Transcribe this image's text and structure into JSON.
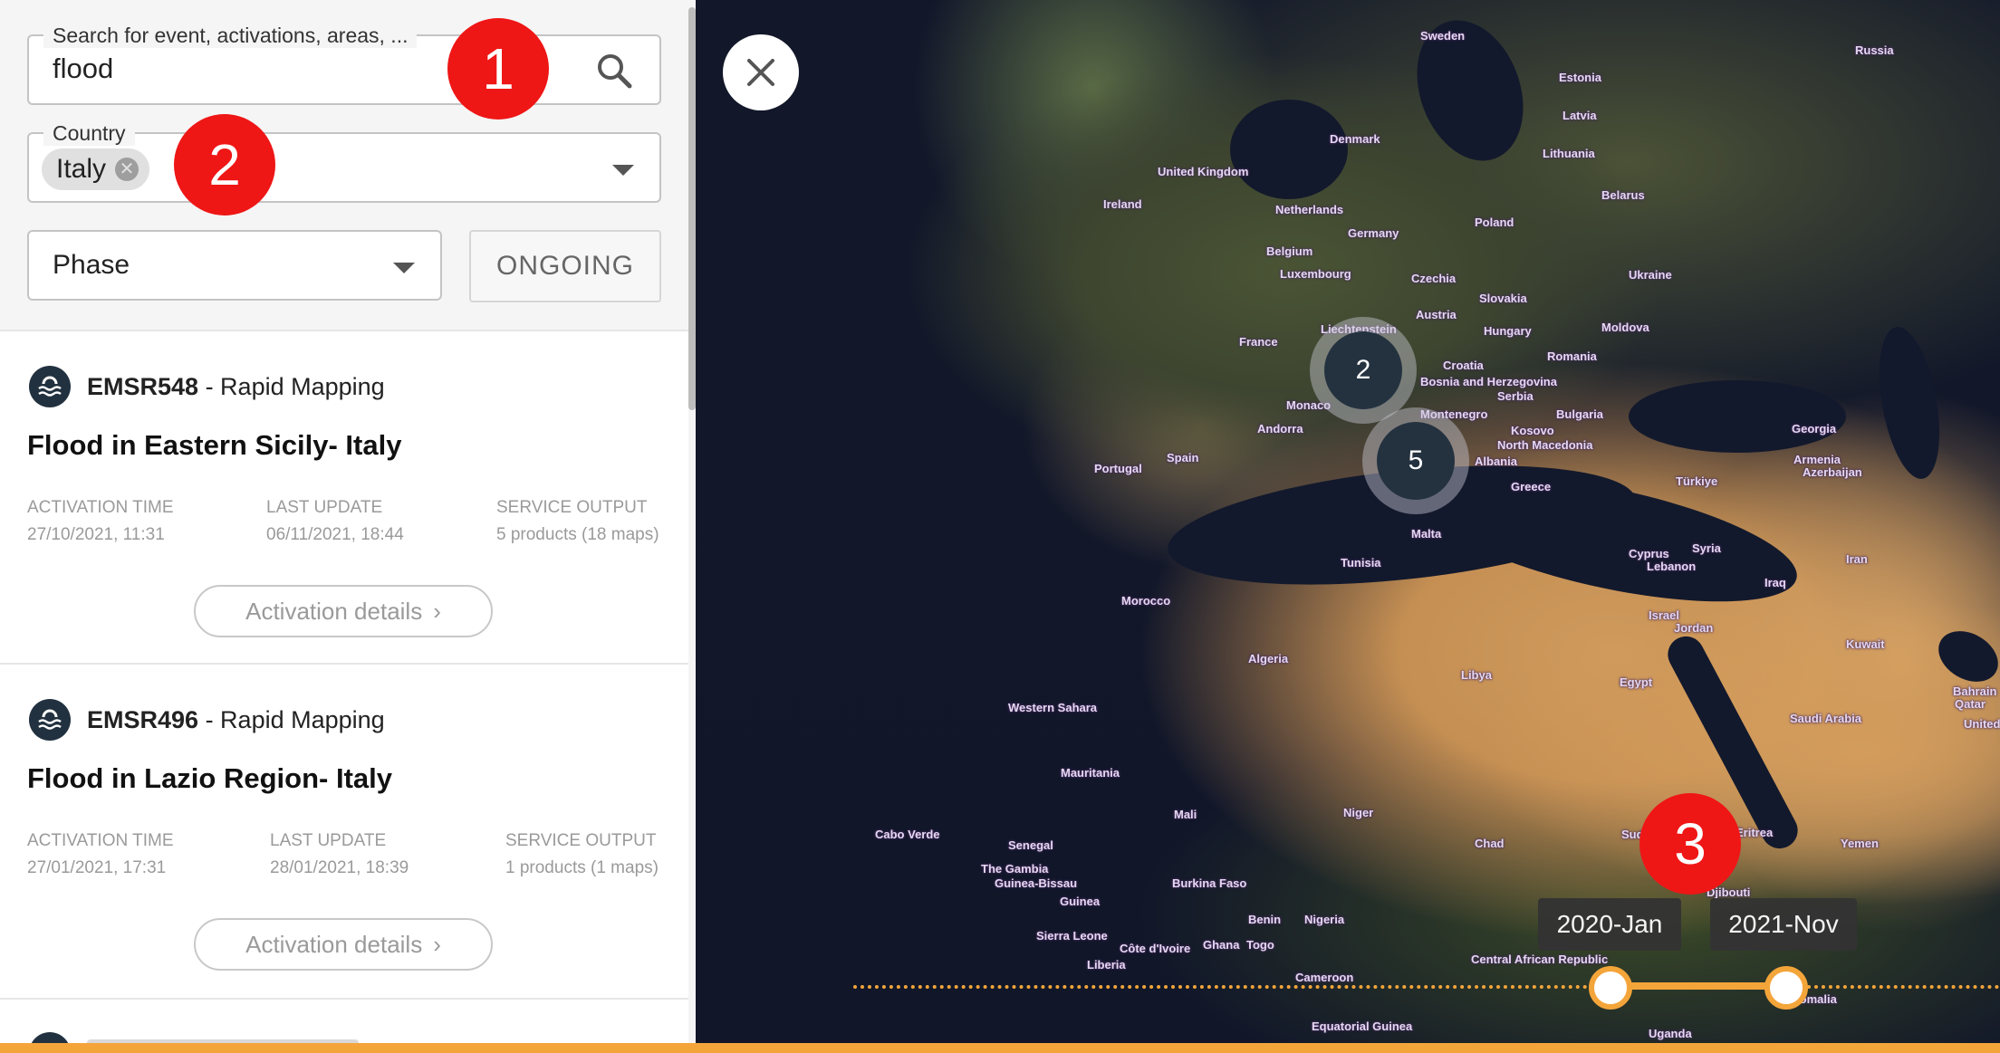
{
  "search": {
    "legend": "Search for event, activations, areas, ...",
    "value": "flood"
  },
  "country": {
    "legend": "Country",
    "chip": "Italy"
  },
  "phase": {
    "value": "Phase"
  },
  "ongoing_label": "ONGOING",
  "activations": [
    {
      "code": "EMSR548",
      "type": " - Rapid Mapping",
      "title": "Flood in Eastern Sicily- Italy",
      "activation_label": "ACTIVATION TIME",
      "activation_time": "27/10/2021, 11:31",
      "update_label": "LAST UPDATE",
      "last_update": "06/11/2021, 18:44",
      "output_label": "SERVICE OUTPUT",
      "service_output": "5 products (18 maps)",
      "details_label": "Activation details"
    },
    {
      "code": "EMSR496",
      "type": " - Rapid Mapping",
      "title": "Flood in Lazio Region- Italy",
      "activation_label": "ACTIVATION TIME",
      "activation_time": "27/01/2021, 17:31",
      "update_label": "LAST UPDATE",
      "last_update": "28/01/2021, 18:39",
      "output_label": "SERVICE OUTPUT",
      "service_output": "1 products (1 maps)",
      "details_label": "Activation details"
    }
  ],
  "map": {
    "clusters": [
      "2",
      "5"
    ],
    "labels": [
      "Sweden",
      "Russia",
      "Estonia",
      "Latvia",
      "Denmark",
      "Lithuania",
      "United Kingdom",
      "Belarus",
      "Ireland",
      "Netherlands",
      "Poland",
      "Germany",
      "Belgium",
      "Luxembourg",
      "Czechia",
      "Ukraine",
      "Slovakia",
      "Austria",
      "Moldova",
      "Hungary",
      "France",
      "Romania",
      "Liechtenstein",
      "Croatia",
      "Bosnia and Herzegovina",
      "Serbia",
      "Monaco",
      "Bulgaria",
      "Montenegro",
      "Andorra",
      "Kosovo",
      "Georgia",
      "North Macedonia",
      "Albania",
      "Armenia",
      "Azerbaijan",
      "Portugal",
      "Spain",
      "Greece",
      "Türkiye",
      "Malta",
      "Tunisia",
      "Cyprus",
      "Syria",
      "Lebanon",
      "Iran",
      "Iraq",
      "Morocco",
      "Israel",
      "Jordan",
      "Kuwait",
      "Algeria",
      "Libya",
      "Egypt",
      "Bahrain",
      "Qatar",
      "Saudi Arabia",
      "United Arab Emirates",
      "Western Sahara",
      "Mauritania",
      "Mali",
      "Niger",
      "Cabo Verde",
      "Senegal",
      "Chad",
      "Sudan",
      "Eritrea",
      "Yemen",
      "The Gambia",
      "Guinea-Bissau",
      "Guinea",
      "Burkina Faso",
      "Djibouti",
      "Sierra Leone",
      "Benin",
      "Nigeria",
      "Côte d'Ivoire",
      "Ghana",
      "Togo",
      "Liberia",
      "Central African Republic",
      "Cameroon",
      "Somalia",
      "Equatorial Guinea",
      "Uganda"
    ]
  },
  "markers": [
    "1",
    "2",
    "3"
  ],
  "timeline": {
    "start": "2020-Jan",
    "end": "2021-Nov"
  }
}
